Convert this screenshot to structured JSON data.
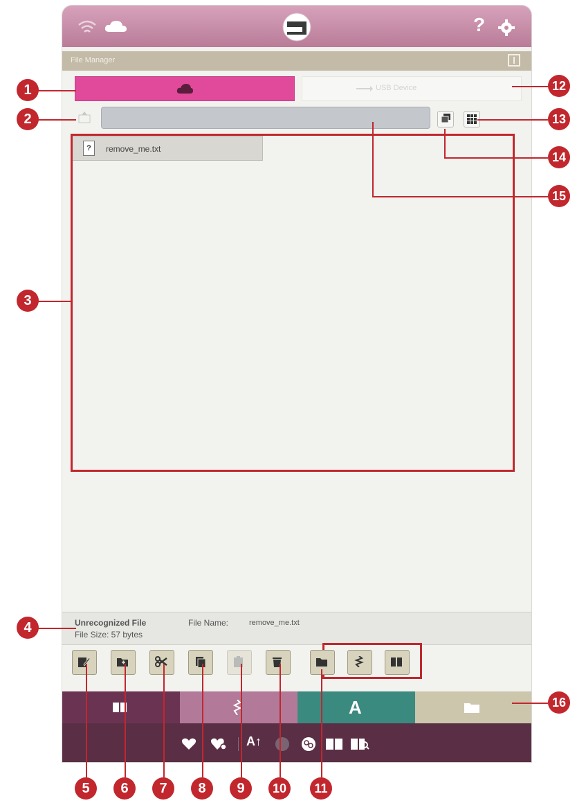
{
  "window": {
    "title": "File Manager"
  },
  "tabs": [
    {
      "name": "internal-memory",
      "label": ""
    },
    {
      "name": "usb-device",
      "label": "USB Device"
    }
  ],
  "file_list": [
    {
      "name": "remove_me.txt",
      "icon": "unknown-file-icon"
    }
  ],
  "info": {
    "type": "Unrecognized File",
    "file_name_label": "File Name:",
    "file_name": "remove_me.txt",
    "file_size": "File Size: 57 bytes"
  },
  "toolbar": [
    "rename-icon",
    "new-folder-icon",
    "cut-icon",
    "copy-icon",
    "paste-icon",
    "delete-icon",
    "folder-icon",
    "stitch-icon",
    "book-icon"
  ],
  "callouts": [
    "1",
    "2",
    "3",
    "4",
    "5",
    "6",
    "7",
    "8",
    "9",
    "10",
    "11",
    "12",
    "13",
    "14",
    "15",
    "16"
  ],
  "colors": {
    "accent_pink": "#e14a9a",
    "status_bar": "#c38aa5",
    "callout_red": "#c1272d",
    "bottom_bar": "#5a2e44",
    "nav_teal": "#3b8a80",
    "nav_plum": "#6b3352"
  }
}
